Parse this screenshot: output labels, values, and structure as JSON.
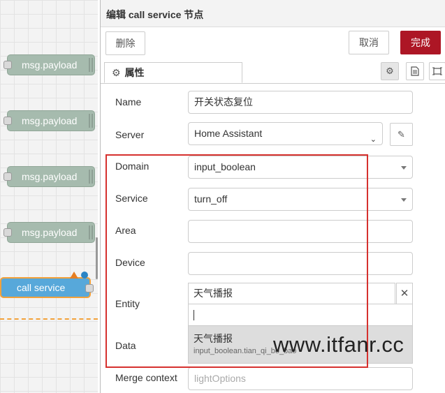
{
  "canvas": {
    "nodes": [
      {
        "label": "msg.payload"
      },
      {
        "label": "msg.payload"
      },
      {
        "label": "msg.payload"
      },
      {
        "label": "msg.payload"
      }
    ],
    "call_node_label": "call service"
  },
  "panel": {
    "title": "编辑 call service 节点",
    "delete_label": "删除",
    "cancel_label": "取消",
    "done_label": "完成",
    "tab_label": "属性",
    "icons": [
      "gear-icon",
      "description-icon",
      "appearance-icon"
    ]
  },
  "form": {
    "name_label": "Name",
    "name_value": "开关状态复位",
    "server_label": "Server",
    "server_value": "Home Assistant",
    "domain_label": "Domain",
    "domain_value": "input_boolean",
    "service_label": "Service",
    "service_value": "turn_off",
    "area_label": "Area",
    "device_label": "Device",
    "entity_label": "Entity",
    "entity_value": "天气播报",
    "dropdown_title": "天气播报",
    "dropdown_sub": "input_boolean.tian_qi_bo_bao",
    "data_label": "Data",
    "merge_label": "Merge context",
    "merge_placeholder": "lightOptions"
  },
  "watermark": "www.itfanr.cc",
  "colors": {
    "primary": "#ad1625",
    "highlight": "#d6312e",
    "node": "#a6bbae",
    "call_node": "#57a8da"
  }
}
